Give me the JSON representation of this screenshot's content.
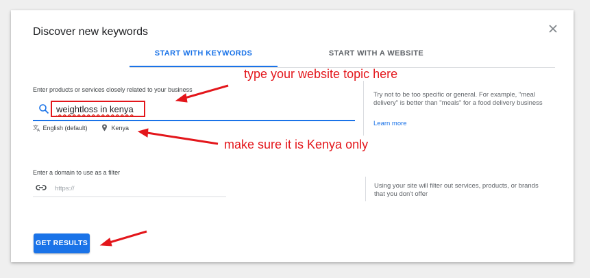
{
  "dialog": {
    "title": "Discover new keywords",
    "close_icon": "close-icon"
  },
  "tabs": [
    {
      "label": "START WITH KEYWORDS",
      "active": true
    },
    {
      "label": "START WITH A WEBSITE",
      "active": false
    }
  ],
  "keywords": {
    "label": "Enter products or services closely related to your business",
    "value": "weightloss in kenya",
    "language": "English (default)",
    "location": "Kenya",
    "tip": "Try not to be too specific or general. For example, \"meal delivery\" is better than \"meals\" for a food delivery business",
    "learn_more": "Learn more"
  },
  "domain_filter": {
    "label": "Enter a domain to use as a filter",
    "placeholder": "https://",
    "tip": "Using your site will filter out services, products, or brands that you don't offer"
  },
  "submit_label": "GET RESULTS",
  "annotations": {
    "topic": "type your website topic here",
    "kenya": "make sure it is Kenya only"
  },
  "colors": {
    "accent": "#1a73e8",
    "annotation": "#e3161b"
  }
}
